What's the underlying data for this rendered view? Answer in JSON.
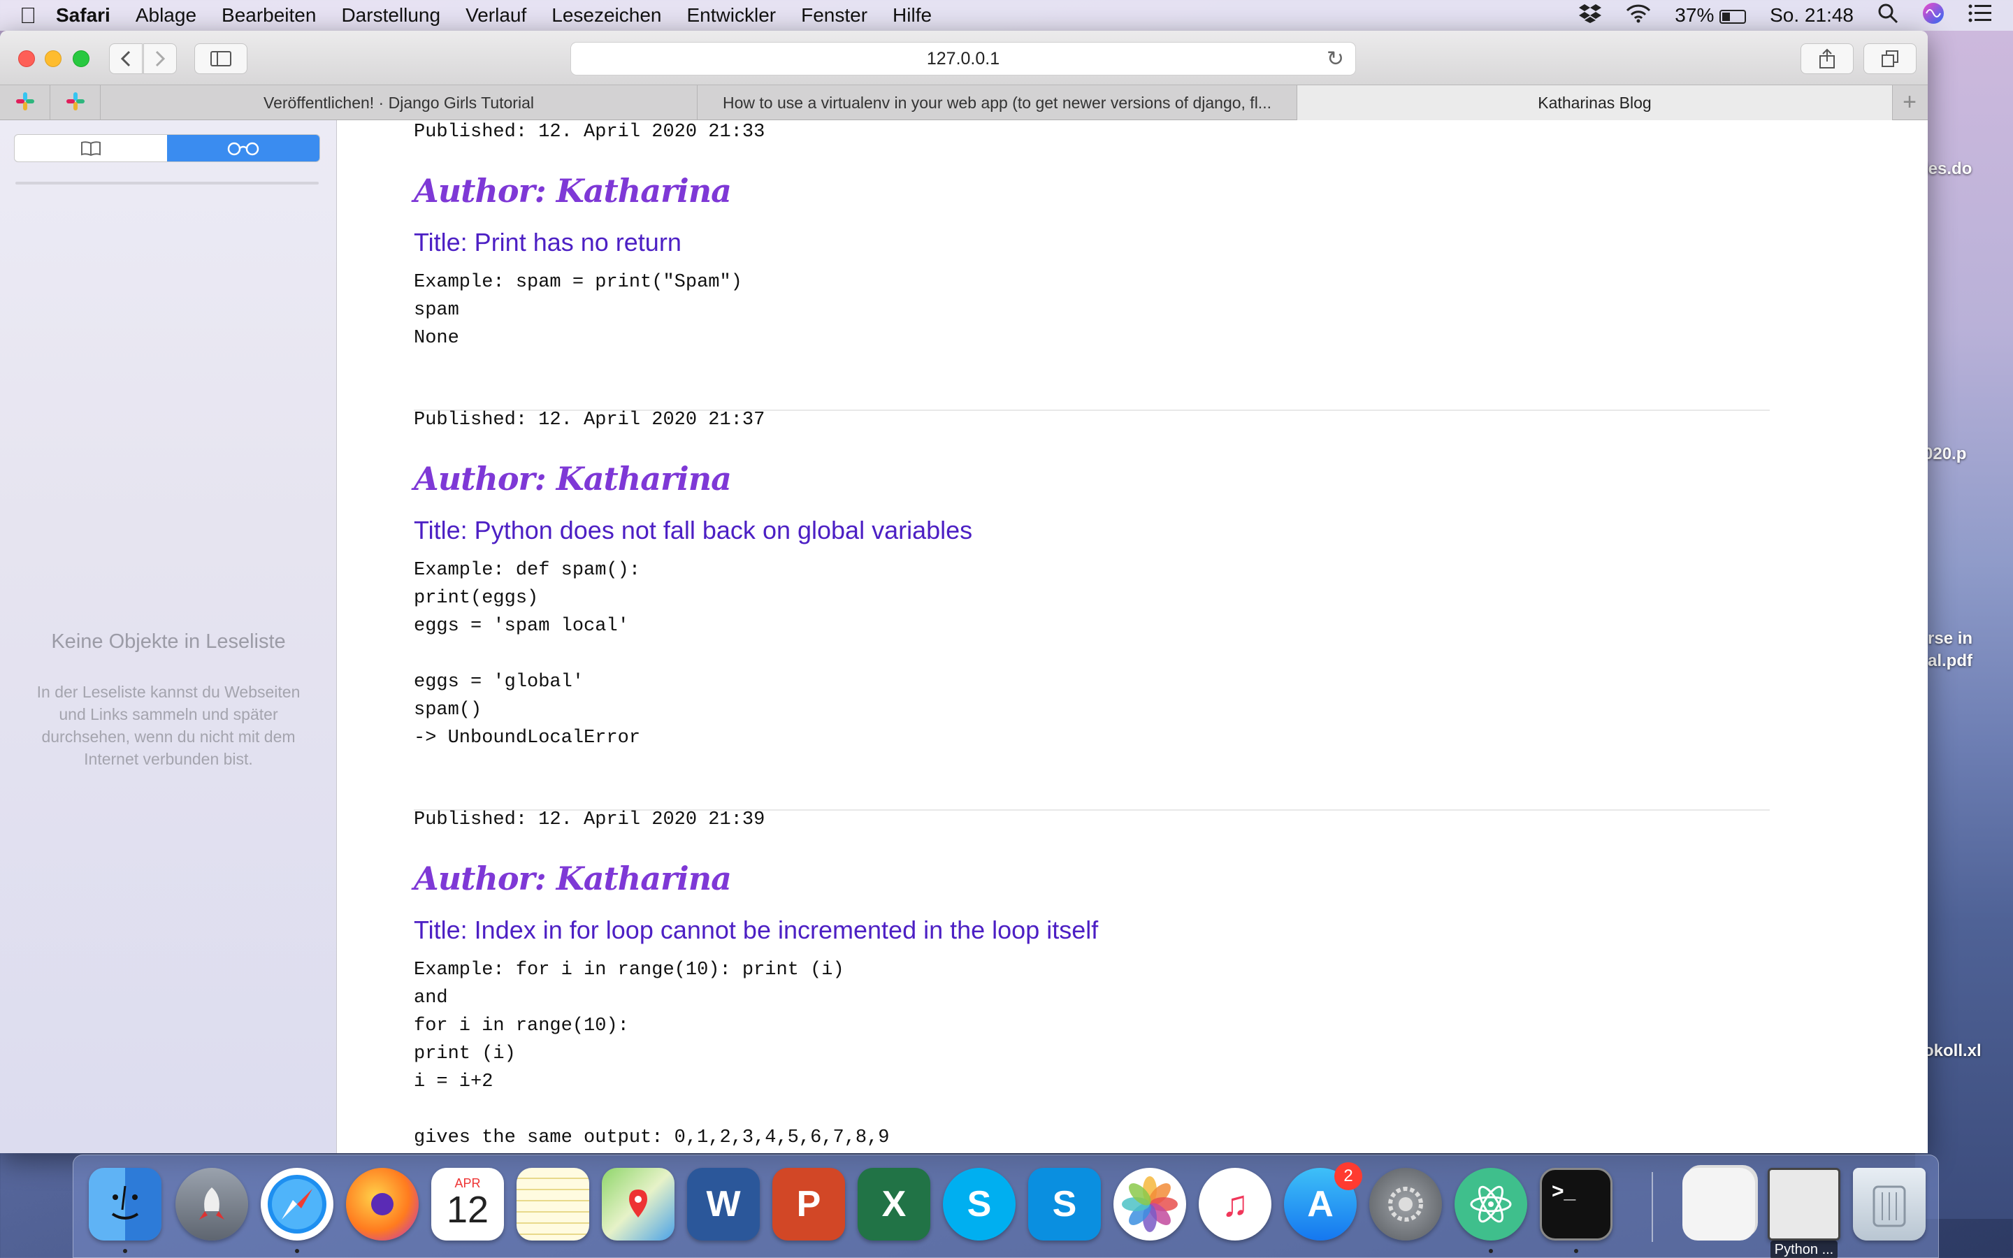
{
  "menubar": {
    "app_name": "Safari",
    "items": [
      "Ablage",
      "Bearbeiten",
      "Darstellung",
      "Verlauf",
      "Lesezeichen",
      "Entwickler",
      "Fenster",
      "Hilfe"
    ],
    "battery": "37%",
    "battery_level": 0.37,
    "clock": "So. 21:48"
  },
  "browser": {
    "url": "127.0.0.1",
    "tabs": [
      {
        "label": "Veröffentlichen! · Django Girls Tutorial",
        "active": false
      },
      {
        "label": "How to use a virtualenv in your web app (to get newer versions of django, fl...",
        "active": false
      },
      {
        "label": "Katharinas Blog",
        "active": true
      }
    ]
  },
  "sidebar": {
    "empty_title": "Keine Objekte in Leseliste",
    "empty_description": "In der Leseliste kannst du Webseiten und Links sammeln und später durchsehen, wenn du nicht mit dem Internet verbunden bist."
  },
  "posts": [
    {
      "published": "Published: 12. April 2020 21:33",
      "author": "Author: Katharina",
      "title": "Title: Print has no return",
      "example": "Example: spam = print(\"Spam\")\nspam\nNone"
    },
    {
      "published": "Published: 12. April 2020 21:37",
      "author": "Author: Katharina",
      "title": "Title: Python does not fall back on global variables",
      "example": "Example: def spam():\nprint(eggs)\neggs = 'spam local'\n\neggs = 'global'\nspam()\n-> UnboundLocalError"
    },
    {
      "published": "Published: 12. April 2020 21:39",
      "author": "Author: Katharina",
      "title": "Title: Index in for loop cannot be incremented in the loop itself",
      "example": "Example: for i in range(10): print (i)\nand\nfor i in range(10):\nprint (i)\ni = i+2\n\ngives the same output: 0,1,2,3,4,5,6,7,8,9"
    }
  ],
  "desktop": {
    "files": [
      "les.do",
      "020.p",
      "rse in",
      "al.pdf",
      "okoll.xl"
    ]
  },
  "dock": {
    "calendar_month": "APR",
    "calendar_day": "12",
    "appstore_badge": "2",
    "python_label": "Python ..."
  }
}
